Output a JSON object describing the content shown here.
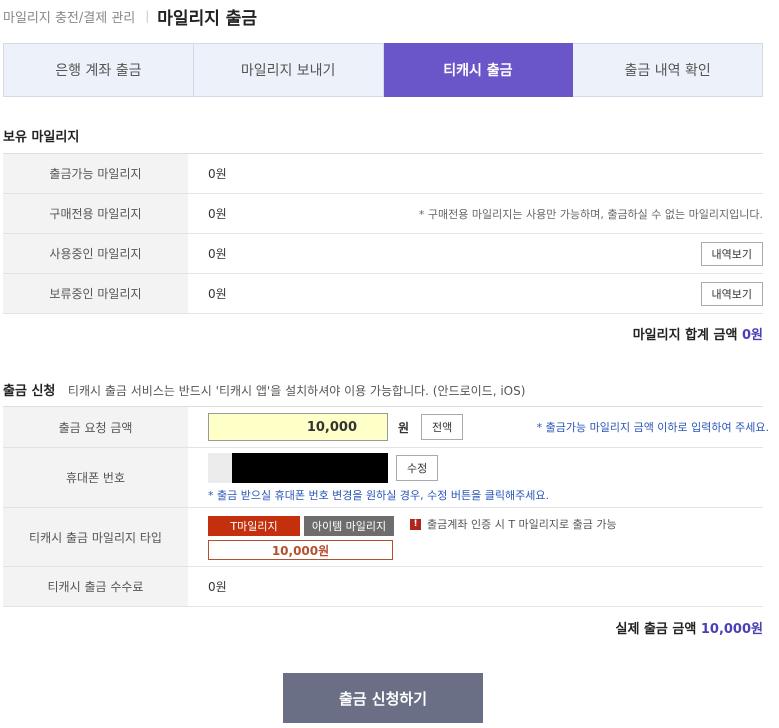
{
  "header": {
    "breadcrumb": "마일리지 충전/결제 관리",
    "separator": "|",
    "title": "마일리지 출금"
  },
  "tabs": [
    {
      "label": "은행 계좌 출금",
      "active": false
    },
    {
      "label": "마일리지 보내기",
      "active": false
    },
    {
      "label": "티캐시 출금",
      "active": true
    },
    {
      "label": "출금 내역 확인",
      "active": false
    }
  ],
  "holdings": {
    "title": "보유 마일리지",
    "rows": [
      {
        "label": "출금가능 마일리지",
        "value": "0원"
      },
      {
        "label": "구매전용 마일리지",
        "value": "0원",
        "note": "* 구매전용 마일리지는 사용만 가능하며, 출금하실 수 없는 마일리지입니다."
      },
      {
        "label": "사용중인 마일리지",
        "value": "0원",
        "button": "내역보기"
      },
      {
        "label": "보류중인 마일리지",
        "value": "0원",
        "button": "내역보기"
      }
    ],
    "total_label": "마일리지 합계 금액",
    "total_value": "0원"
  },
  "request": {
    "title": "출금 신청",
    "description": "티캐시 출금 서비스는 반드시 '티캐시 앱'을 설치하셔야 이용 가능합니다. (안드로이드, iOS)",
    "amount_label": "출금 요청 금액",
    "amount_value": "10,000",
    "amount_unit": "원",
    "all_button": "전액",
    "amount_note": "* 출금가능 마일리지 금액 이하로 입력하여 주세요.",
    "phone_label": "휴대폰 번호",
    "edit_button": "수정",
    "phone_note": "* 출금 받으실 휴대폰 번호 변경을 원하실 경우, 수정 버튼을 클릭해주세요.",
    "type_label": "티캐시 출금 마일리지 타입",
    "type_t": "T마일리지",
    "type_item": "아이템 마일리지",
    "type_warning": "출금계좌 인증 시 T 마일리지로 출금 가능",
    "type_amount": "10,000원",
    "fee_label": "티캐시 출금 수수료",
    "fee_value": "0원",
    "actual_label": "실제 출금 금액",
    "actual_value": "10,000원"
  },
  "submit_label": "출금 신청하기",
  "colors": {
    "accent": "#6a55c9",
    "tmileage": "#c4300e",
    "submit": "#6a6f85",
    "note_blue": "#2a56b8"
  }
}
